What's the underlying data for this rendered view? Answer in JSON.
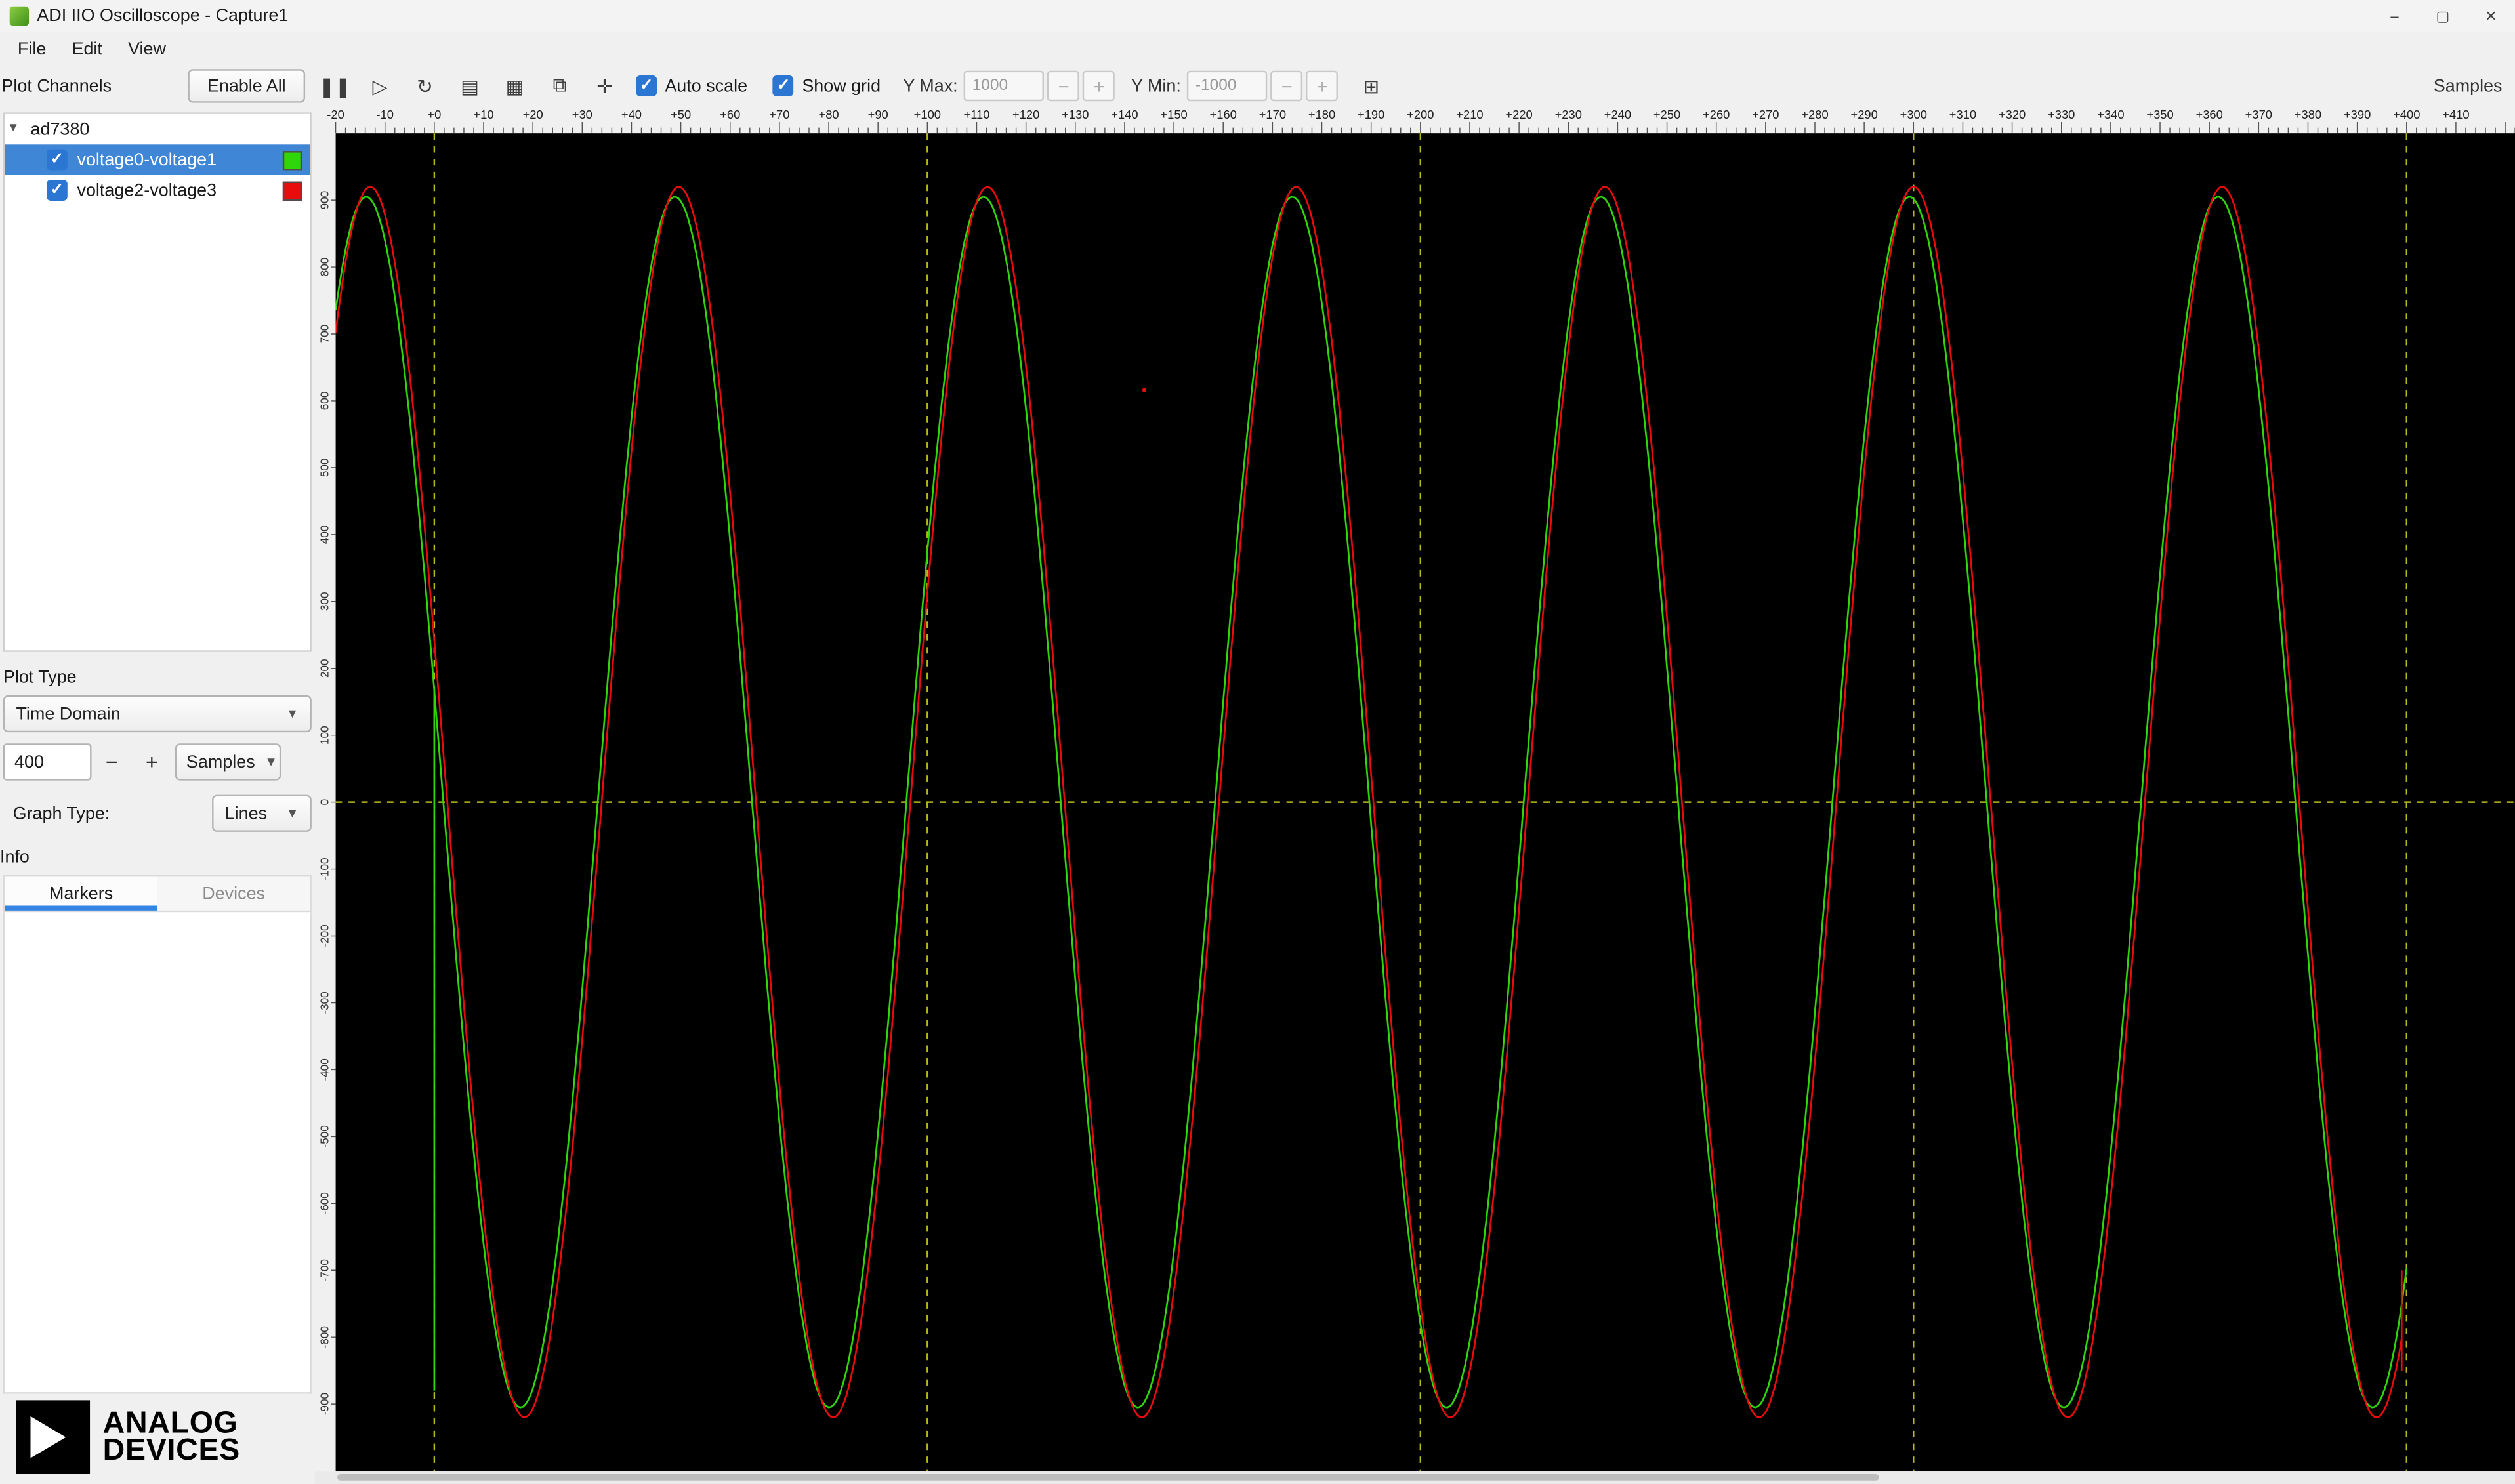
{
  "window": {
    "title": "ADI IIO Oscilloscope - Capture1",
    "minimize": "–",
    "maximize": "▢",
    "close": "✕"
  },
  "menu": {
    "items": [
      "File",
      "Edit",
      "View"
    ]
  },
  "toolbar": {
    "plot_channels_label": "Plot Channels",
    "enable_all": "Enable All",
    "icons": [
      {
        "name": "capture-pause-icon",
        "glyph": "❚❚"
      },
      {
        "name": "capture-play-icon",
        "glyph": "▷"
      },
      {
        "name": "capture-loop-icon",
        "glyph": "↻"
      },
      {
        "name": "device-list-icon",
        "glyph": "▤"
      },
      {
        "name": "plot-layout-icon",
        "glyph": "▦"
      },
      {
        "name": "snapshot-icon",
        "glyph": "⧉"
      },
      {
        "name": "pan-icon",
        "glyph": "✛"
      }
    ],
    "auto_scale": {
      "label": "Auto scale",
      "checked": true
    },
    "show_grid": {
      "label": "Show grid",
      "checked": true
    },
    "y_max": {
      "label": "Y Max:",
      "value": "1000",
      "minus": "−",
      "plus": "+"
    },
    "y_min": {
      "label": "Y Min:",
      "value": "-1000",
      "minus": "−",
      "plus": "+"
    },
    "new_plot": {
      "name": "new-plot-icon",
      "glyph": "⊞"
    },
    "samples_label": "Samples"
  },
  "sidebar": {
    "device": "ad7380",
    "channels": [
      {
        "label": "voltage0-voltage1",
        "checked": true,
        "selected": true,
        "color": "#30d50a"
      },
      {
        "label": "voltage2-voltage3",
        "checked": true,
        "selected": false,
        "color": "#e80c0c"
      }
    ],
    "plot_type_label": "Plot Type",
    "plot_type_value": "Time Domain",
    "sample_count": "400",
    "sample_minus": "−",
    "sample_plus": "+",
    "sample_unit": "Samples",
    "graph_type_label": "Graph Type:",
    "graph_type_value": "Lines",
    "info_label": "Info",
    "tabs": [
      {
        "label": "Markers",
        "active": true
      },
      {
        "label": "Devices",
        "active": false
      }
    ],
    "logo_line1": "ANALOG",
    "logo_line2": "DEVICES"
  },
  "chart_data": {
    "type": "line",
    "title": "",
    "x_axis": {
      "label": "Samples",
      "min": -20,
      "max": 422,
      "tick_major": 10,
      "tick_minor": 2,
      "grid_lines": [
        0,
        100,
        200,
        300,
        400
      ],
      "label_format": "signed"
    },
    "y_axis": {
      "min": -1000,
      "max": 1000,
      "label_step": 100,
      "grid_lines": [
        0
      ]
    },
    "grid_color": "#b8b818",
    "background": "#000000",
    "series": [
      {
        "name": "voltage0-voltage1",
        "color": "#30d50a",
        "waveform": "sine",
        "amplitude": 905,
        "period_samples": 62.6,
        "peak_at_sample": 48.8,
        "x_start": -20,
        "x_end": 400,
        "transient": {
          "x": 0,
          "v_from": -880,
          "v_to": 170
        }
      },
      {
        "name": "voltage2-voltage3",
        "color": "#e80c0c",
        "waveform": "sine",
        "amplitude": 920,
        "period_samples": 62.6,
        "peak_at_sample": 49.6,
        "x_start": -20,
        "x_end": 399,
        "transient": {
          "x": 399,
          "v_from": -850,
          "v_to": -700
        }
      }
    ],
    "artifact_dot": {
      "x": 144,
      "v": 616,
      "color": "#e80c0c"
    }
  }
}
